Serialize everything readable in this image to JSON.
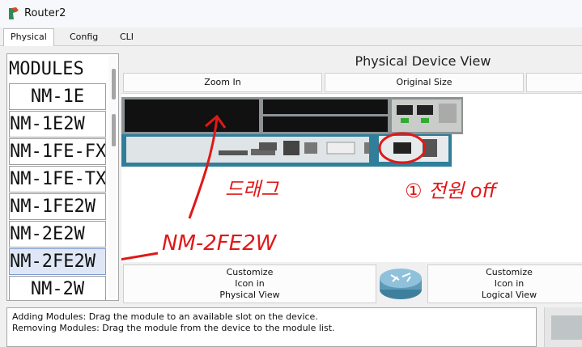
{
  "window": {
    "title": "Router2"
  },
  "tabs": [
    {
      "label": "Physical",
      "active": true
    },
    {
      "label": "Config",
      "active": false
    },
    {
      "label": "CLI",
      "active": false
    }
  ],
  "modules": {
    "header": "MODULES",
    "items": [
      "NM-1E",
      "NM-1E2W",
      "NM-1FE-FX",
      "NM-1FE-TX",
      "NM-1FE2W",
      "NM-2E2W",
      "NM-2FE2W",
      "NM-2W"
    ],
    "selected": "NM-2FE2W"
  },
  "physical_view": {
    "title": "Physical Device View",
    "zoom_in": "Zoom In",
    "original_size": "Original Size"
  },
  "buttons": {
    "customize_physical": [
      "Customize",
      "Icon in",
      "Physical View"
    ],
    "customize_logical": [
      "Customize",
      "Icon in",
      "Logical View"
    ]
  },
  "info": {
    "line1": "Adding Modules: Drag the module to an available slot on the device.",
    "line2": "Removing Modules: Drag the module from the device to the module list."
  },
  "annotations": {
    "drag": "드래그",
    "power": "① 전원 off",
    "module": "NM-2FE2W"
  },
  "colors": {
    "annotation": "#e01818",
    "selected_bg": "#dfe7f6"
  }
}
